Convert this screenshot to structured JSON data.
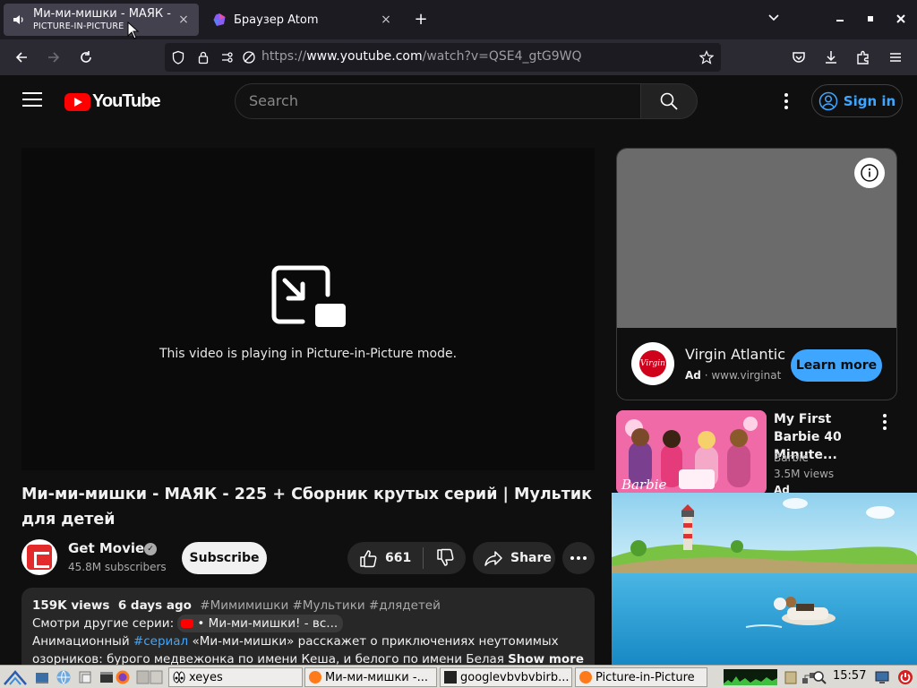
{
  "browser": {
    "tabs": [
      {
        "title": "Ми-ми-мишки - МАЯК -",
        "subtitle": "PICTURE-IN-PICTURE",
        "close": "×"
      },
      {
        "title": "Браузер Atom",
        "close": "×"
      }
    ],
    "new_tab": "+",
    "tab_list": "⌄",
    "url_prefix": "https://",
    "url_domain": "www.youtube.com",
    "url_path": "/watch?v=QSE4_gtG9WQ",
    "window_controls": {
      "minimize": "–",
      "maximize": "▪",
      "close": "✕"
    }
  },
  "youtube": {
    "logo_text": "YouTube",
    "search_placeholder": "Search",
    "signin_label": "Sign in",
    "player": {
      "pip_message": "This video is playing in Picture-in-Picture mode."
    },
    "video": {
      "title": "Ми-ми-мишки - МАЯК - 225 + Сборник крутых серий | Мультик для детей",
      "channel_name": "Get Movies",
      "verified": "✓",
      "subscribers": "45.8M subscribers",
      "subscribe_label": "Subscribe",
      "like_count": "661",
      "share_label": "Share"
    },
    "description": {
      "views": "159K views",
      "date": "6 days ago",
      "hashtags": "#Мимимишки #Мультики #длядетей",
      "line2_prefix": "Смотри другие серии:",
      "line2_chip": "• Ми-ми-мишки! - вс...",
      "line3_a": "Анимационный ",
      "line3_link": "#сериал",
      "line3_b": " «Ми-ми-мишки» расскажет о приключениях неутомимых",
      "line4": "озорников: бурого медвежонка по имени Кеша, и белого по имени Белая Тучка. А",
      "show_more": "Show more"
    },
    "ad": {
      "title": "Virgin Atlantic",
      "badge": "Ad",
      "domain": "www.virginatlantic.com",
      "cta": "Learn more",
      "logo_text": "Virgin",
      "info": "i"
    },
    "recommended": [
      {
        "title": "My First Barbie 40 Minute...",
        "channel": "Barbie",
        "views": "3.5M views",
        "badge": "Ad",
        "thumb_text": "Barbie"
      }
    ]
  },
  "taskbar": {
    "tasks": [
      {
        "label": "xeyes"
      },
      {
        "label": "Ми-ми-мишки -..."
      },
      {
        "label": "googlevbvbvbirb..."
      },
      {
        "label": "Picture-in-Picture"
      }
    ],
    "clock": "15:57"
  }
}
